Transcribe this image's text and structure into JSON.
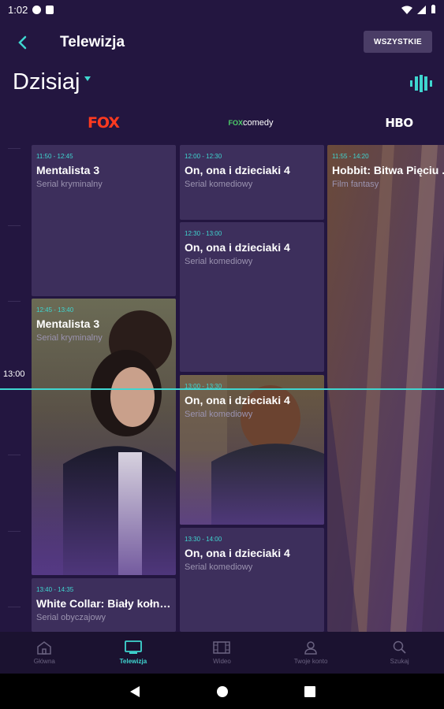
{
  "status_bar": {
    "time": "1:02"
  },
  "app_bar": {
    "title": "Telewizja",
    "all_button": "WSZYSTKIE"
  },
  "date": {
    "label": "Dzisiaj"
  },
  "channels": {
    "fox": "FOX",
    "foxcomedy_fox": "FOX",
    "foxcomedy_rest": "comedy",
    "hbo": "HBO"
  },
  "timeline": {
    "label": "13:00"
  },
  "programs": [
    {
      "time": "11:50 - 12:45",
      "title": "Mentalista 3",
      "genre": "Serial kryminalny"
    },
    {
      "time": "12:45 - 13:40",
      "title": "Mentalista 3",
      "genre": "Serial kryminalny"
    },
    {
      "time": "13:40 - 14:35",
      "title": "White Collar: Biały kołnierzyk",
      "genre": "Serial obyczajowy"
    },
    {
      "time": "12:00 - 12:30",
      "title": "On, ona i dzieciaki 4",
      "genre": "Serial komediowy"
    },
    {
      "time": "12:30 - 13:00",
      "title": "On, ona i dzieciaki 4",
      "genre": "Serial komediowy"
    },
    {
      "time": "13:00 - 13:30",
      "title": "On, ona i dzieciaki 4",
      "genre": "Serial komediowy"
    },
    {
      "time": "13:30 - 14:00",
      "title": "On, ona i dzieciaki 4",
      "genre": "Serial komediowy"
    },
    {
      "time": "11:55 - 14:20",
      "title": "Hobbit: Bitwa Pięciu Armii",
      "genre": "Film fantasy"
    }
  ],
  "bottom_nav": [
    {
      "label": "Główna",
      "icon": "home-icon"
    },
    {
      "label": "Telewizja",
      "icon": "tv-icon"
    },
    {
      "label": "Wideo",
      "icon": "film-icon"
    },
    {
      "label": "Twoje konto",
      "icon": "user-icon"
    },
    {
      "label": "Szukaj",
      "icon": "search-icon"
    }
  ],
  "colors": {
    "accent": "#3fd6d0",
    "background": "#231640",
    "card": "#3d2f5c",
    "fox_brand": "#ff3a1f"
  }
}
